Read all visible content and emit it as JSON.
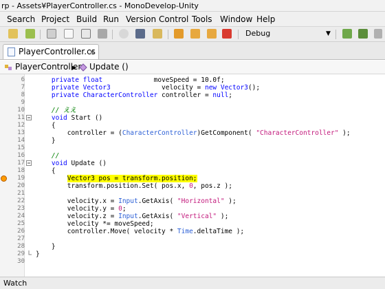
{
  "window": {
    "title": "rp - Assets¥PlayerController.cs - MonoDevelop-Unity"
  },
  "menu": {
    "items": [
      "Search",
      "Project",
      "Build",
      "Run",
      "Version Control",
      "Tools",
      "Window",
      "Help"
    ]
  },
  "toolbar": {
    "icons": [
      "back-icon",
      "forward-icon",
      "cut-icon",
      "copy-icon",
      "paste-icon",
      "save-icon",
      "find-icon",
      "binoculars-icon",
      "replace-icon",
      "bookmark-icon",
      "bookmark-prev-icon",
      "bookmark-next-icon",
      "clear-bookmarks-icon",
      "deploy-icon",
      "build-icon",
      "attach-icon"
    ],
    "configuration": "Debug"
  },
  "tabs": [
    {
      "label": "PlayerController.cs",
      "close": "×"
    }
  ],
  "breadcrumb": {
    "class_name": "PlayerController",
    "separator": "▶",
    "method_name": "Update ()"
  },
  "editor": {
    "lines": [
      {
        "n": "6",
        "fold": "",
        "tokens": [
          [
            "    ",
            "p"
          ],
          [
            "private float",
            "kw"
          ],
          [
            "             moveSpeed = 10.0f;",
            "p"
          ]
        ]
      },
      {
        "n": "7",
        "fold": "",
        "tokens": [
          [
            "    ",
            "p"
          ],
          [
            "private Vector3",
            "kw"
          ],
          [
            "             velocity = ",
            "p"
          ],
          [
            "new Vector3",
            "kw"
          ],
          [
            "();",
            "p"
          ]
        ]
      },
      {
        "n": "8",
        "fold": "",
        "tokens": [
          [
            "    ",
            "p"
          ],
          [
            "private CharacterController",
            "kw"
          ],
          [
            " controller = ",
            "p"
          ],
          [
            "null",
            "kw"
          ],
          [
            ";",
            "p"
          ]
        ]
      },
      {
        "n": "9",
        "fold": "",
        "tokens": []
      },
      {
        "n": "10",
        "fold": "",
        "tokens": [
          [
            "    ",
            "p"
          ],
          [
            "// ええ",
            "cmt"
          ]
        ]
      },
      {
        "n": "11",
        "fold": "open",
        "tokens": [
          [
            "    ",
            "p"
          ],
          [
            "void",
            "kw"
          ],
          [
            " Start ()",
            "p"
          ]
        ]
      },
      {
        "n": "12",
        "fold": "",
        "tokens": [
          [
            "    {",
            "p"
          ]
        ]
      },
      {
        "n": "13",
        "fold": "",
        "tokens": [
          [
            "        controller = (",
            "p"
          ],
          [
            "CharacterController",
            "type"
          ],
          [
            ")GetComponent( ",
            "p"
          ],
          [
            "\"CharacterController\"",
            "str"
          ],
          [
            " );",
            "p"
          ]
        ]
      },
      {
        "n": "14",
        "fold": "",
        "tokens": [
          [
            "    }",
            "p"
          ]
        ]
      },
      {
        "n": "15",
        "fold": "",
        "tokens": []
      },
      {
        "n": "16",
        "fold": "",
        "tokens": [
          [
            "    ",
            "p"
          ],
          [
            "//",
            "cmt"
          ]
        ]
      },
      {
        "n": "17",
        "fold": "open",
        "tokens": [
          [
            "    ",
            "p"
          ],
          [
            "void",
            "kw"
          ],
          [
            " Update ()",
            "p"
          ]
        ]
      },
      {
        "n": "18",
        "fold": "",
        "tokens": [
          [
            "    {",
            "p"
          ]
        ]
      },
      {
        "n": "19",
        "fold": "",
        "breakpoint": true,
        "tokens": [
          [
            "        Vector3 pos = transform.position;",
            "p"
          ]
        ]
      },
      {
        "n": "20",
        "fold": "",
        "tokens": [
          [
            "        transform.position.Set( pos.x, ",
            "p"
          ],
          [
            "0",
            "str"
          ],
          [
            ", pos.z );",
            "p"
          ]
        ]
      },
      {
        "n": "21",
        "fold": "",
        "tokens": []
      },
      {
        "n": "22",
        "fold": "",
        "tokens": [
          [
            "        velocity.x = ",
            "p"
          ],
          [
            "Input",
            "type"
          ],
          [
            ".GetAxis( ",
            "p"
          ],
          [
            "\"Horizontal\"",
            "str"
          ],
          [
            " );",
            "p"
          ]
        ]
      },
      {
        "n": "23",
        "fold": "",
        "tokens": [
          [
            "        velocity.y = ",
            "p"
          ],
          [
            "0",
            "str"
          ],
          [
            ";",
            "p"
          ]
        ]
      },
      {
        "n": "24",
        "fold": "",
        "tokens": [
          [
            "        velocity.z = ",
            "p"
          ],
          [
            "Input",
            "type"
          ],
          [
            ".GetAxis( ",
            "p"
          ],
          [
            "\"Vertical\"",
            "str"
          ],
          [
            " );",
            "p"
          ]
        ]
      },
      {
        "n": "25",
        "fold": "",
        "tokens": [
          [
            "        velocity *= moveSpeed;",
            "p"
          ]
        ]
      },
      {
        "n": "26",
        "fold": "",
        "tokens": [
          [
            "        controller.Move( velocity * ",
            "p"
          ],
          [
            "Time",
            "type"
          ],
          [
            ".deltaTime );",
            "p"
          ]
        ]
      },
      {
        "n": "27",
        "fold": "",
        "tokens": []
      },
      {
        "n": "28",
        "fold": "",
        "tokens": [
          [
            "    }",
            "p"
          ]
        ]
      },
      {
        "n": "29",
        "fold": "end",
        "tokens": [
          [
            "}",
            "p"
          ]
        ]
      },
      {
        "n": "30",
        "fold": "",
        "tokens": []
      }
    ]
  },
  "colors": {
    "keyword": "#0000ff",
    "type": "#2b5fd6",
    "string": "#c2187b",
    "comment": "#008000",
    "highlight": "#ffff00",
    "breakpoint": "#ff9b00"
  },
  "status": {
    "pad_label": "Watch"
  }
}
